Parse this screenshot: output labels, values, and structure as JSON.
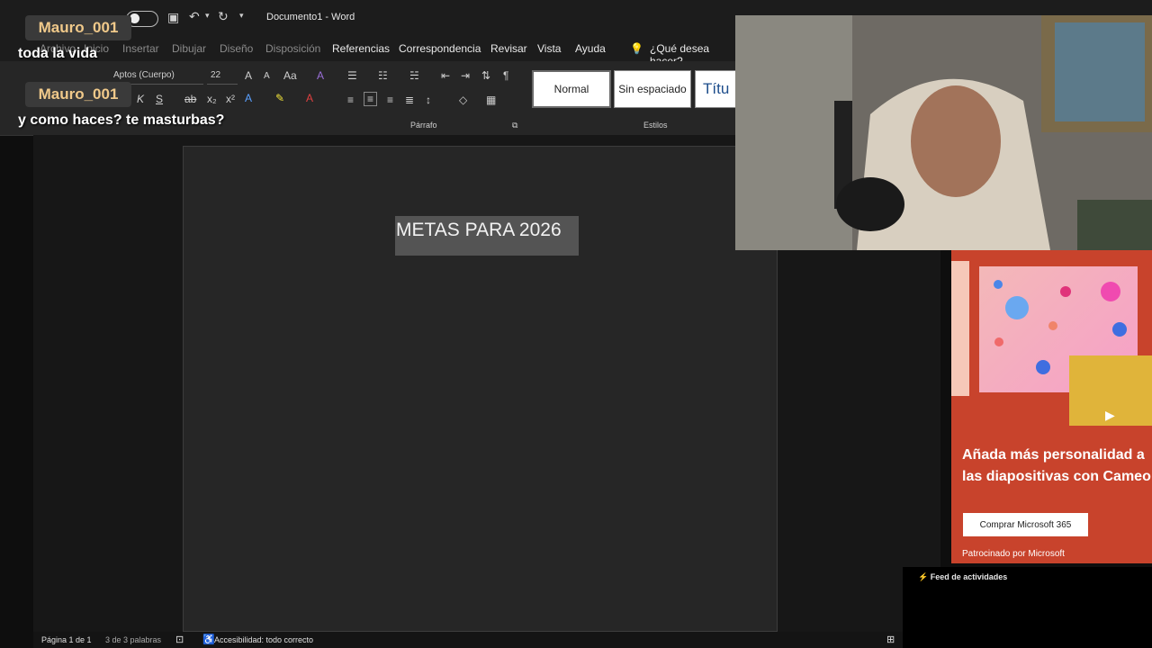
{
  "window": {
    "title": "Documento1 - Word"
  },
  "menu": {
    "tabs": [
      "Archivo",
      "Inicio",
      "Insertar",
      "Dibujar",
      "Diseño",
      "Disposición",
      "Referencias",
      "Correspondencia",
      "Revisar",
      "Vista",
      "Ayuda"
    ],
    "tell_me": "¿Qué desea hacer?"
  },
  "ribbon": {
    "font_name": "Aptos (Cuerpo)",
    "font_size": "22",
    "case_label": "Aa",
    "paragraph_group": "Párrafo",
    "styles_group": "Estilos",
    "styles": [
      "Normal",
      "Sin espaciado",
      "Títu"
    ]
  },
  "document": {
    "heading": "METAS PARA 2026"
  },
  "status": {
    "page": "Página 1 de 1",
    "words": "3 de 3 palabras",
    "accessibility": "Accesibilidad: todo correcto"
  },
  "chat": [
    {
      "user": "Mauro_001",
      "message": "toda la vida"
    },
    {
      "user": "Mauro_001",
      "message": "y como haces? te masturbas?"
    }
  ],
  "ad": {
    "headline": "Añada más personalidad a las diapositivas con Cameo",
    "button": "Comprar Microsoft 365",
    "sponsor": "Patrocinado por Microsoft"
  },
  "feed": {
    "label": "Feed de actividades"
  },
  "colors": {
    "ad_background": "#c8432c",
    "chat_username": "#f0c98a",
    "page_background": "#262626"
  }
}
